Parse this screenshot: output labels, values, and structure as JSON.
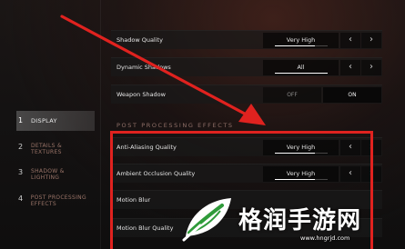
{
  "nav": [
    {
      "num": "1",
      "label": "DISPLAY",
      "active": true
    },
    {
      "num": "2",
      "label": "DETAILS & TEXTURES"
    },
    {
      "num": "3",
      "label": "SHADOW & LIGHTING"
    },
    {
      "num": "4",
      "label": "POST PROCESSING EFFECTS"
    }
  ],
  "rows": {
    "shadow_quality": {
      "label": "Shadow Quality",
      "value": "Very High",
      "level": 0.75
    },
    "dynamic_shadows": {
      "label": "Dynamic Shadows",
      "value": "All",
      "level": 1.0
    },
    "weapon_shadow": {
      "label": "Weapon Shadow",
      "off": "OFF",
      "on": "ON"
    },
    "anti_aliasing": {
      "label": "Anti-Aliasing Quality",
      "value": "Very High",
      "level": 0.75
    },
    "ambient_occlusion": {
      "label": "Ambient Occlusion Quality",
      "value": "Very High",
      "level": 0.75
    },
    "motion_blur": {
      "label": "Motion Blur"
    },
    "motion_blur_quality": {
      "label": "Motion Blur Quality"
    }
  },
  "section_title": "POST PROCESSING EFFECTS",
  "arrows": {
    "left": "‹",
    "right": "›"
  },
  "watermark": {
    "text": "格润手游网",
    "url": "www.hngrjd.com"
  },
  "colors": {
    "annotation": "#e0221f",
    "watermark_green": "#2f9b3a"
  }
}
